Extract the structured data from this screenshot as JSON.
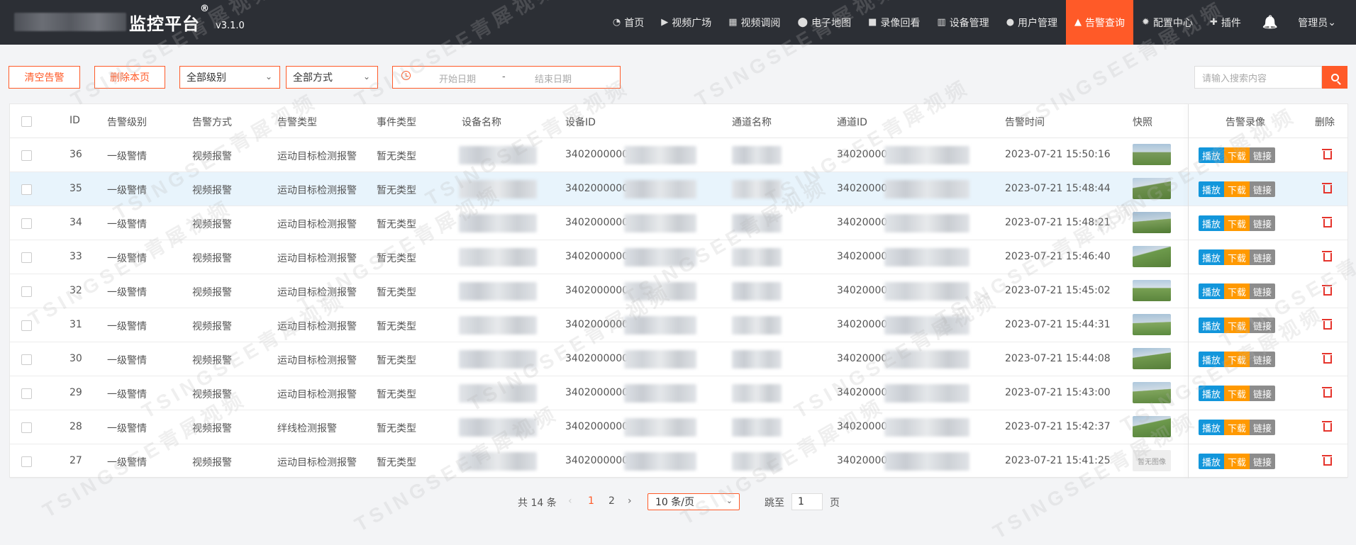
{
  "header": {
    "title": "监控平台",
    "registered": "®",
    "version": "v3.1.0",
    "nav": [
      {
        "label": "首页",
        "icon": "dashboard-icon"
      },
      {
        "label": "视频广场",
        "icon": "play-circle-icon"
      },
      {
        "label": "视频调阅",
        "icon": "grid-icon"
      },
      {
        "label": "电子地图",
        "icon": "map-pin-icon"
      },
      {
        "label": "录像回看",
        "icon": "video-camera-icon"
      },
      {
        "label": "设备管理",
        "icon": "columns-icon"
      },
      {
        "label": "用户管理",
        "icon": "user-icon"
      },
      {
        "label": "告警查询",
        "icon": "alarm-icon",
        "active": true
      },
      {
        "label": "配置中心",
        "icon": "gear-icon"
      },
      {
        "label": "插件",
        "icon": "puzzle-icon"
      }
    ],
    "user": "管理员",
    "accent": "#ff5a28"
  },
  "toolbar": {
    "clear_label": "清空告警",
    "delete_page_label": "删除本页",
    "level_select": "全部级别",
    "method_select": "全部方式",
    "start_date_placeholder": "开始日期",
    "date_sep": "-",
    "end_date_placeholder": "结束日期",
    "search_placeholder": "请输入搜索内容"
  },
  "table": {
    "columns": [
      "ID",
      "告警级别",
      "告警方式",
      "告警类型",
      "事件类型",
      "设备名称",
      "设备ID",
      "通道名称",
      "通道ID",
      "告警时间",
      "快照",
      "告警录像",
      "删除"
    ],
    "rows": [
      {
        "id": "36",
        "level": "一级警情",
        "method": "视频报警",
        "type": "运动目标检测报警",
        "event": "暂无类型",
        "device_id": "3402000000",
        "channel_id": "34020000",
        "time": "2023-07-21 15:50:16"
      },
      {
        "id": "35",
        "level": "一级警情",
        "method": "视频报警",
        "type": "运动目标检测报警",
        "event": "暂无类型",
        "device_id": "3402000000",
        "channel_id": "34020000",
        "time": "2023-07-21 15:48:44"
      },
      {
        "id": "34",
        "level": "一级警情",
        "method": "视频报警",
        "type": "运动目标检测报警",
        "event": "暂无类型",
        "device_id": "3402000000",
        "channel_id": "34020000",
        "time": "2023-07-21 15:48:21"
      },
      {
        "id": "33",
        "level": "一级警情",
        "method": "视频报警",
        "type": "运动目标检测报警",
        "event": "暂无类型",
        "device_id": "3402000000",
        "channel_id": "34020000",
        "time": "2023-07-21 15:46:40"
      },
      {
        "id": "32",
        "level": "一级警情",
        "method": "视频报警",
        "type": "运动目标检测报警",
        "event": "暂无类型",
        "device_id": "3402000000",
        "channel_id": "34020000",
        "time": "2023-07-21 15:45:02"
      },
      {
        "id": "31",
        "level": "一级警情",
        "method": "视频报警",
        "type": "运动目标检测报警",
        "event": "暂无类型",
        "device_id": "3402000000",
        "channel_id": "34020000",
        "time": "2023-07-21 15:44:31"
      },
      {
        "id": "30",
        "level": "一级警情",
        "method": "视频报警",
        "type": "运动目标检测报警",
        "event": "暂无类型",
        "device_id": "3402000000",
        "channel_id": "34020000",
        "time": "2023-07-21 15:44:08"
      },
      {
        "id": "29",
        "level": "一级警情",
        "method": "视频报警",
        "type": "运动目标检测报警",
        "event": "暂无类型",
        "device_id": "3402000000",
        "channel_id": "34020000",
        "time": "2023-07-21 15:43:00"
      },
      {
        "id": "28",
        "level": "一级警情",
        "method": "视频报警",
        "type": "绊线检测报警",
        "event": "暂无类型",
        "device_id": "3402000000",
        "channel_id": "34020000",
        "time": "2023-07-21 15:42:37"
      },
      {
        "id": "27",
        "level": "一级警情",
        "method": "视频报警",
        "type": "运动目标检测报警",
        "event": "暂无类型",
        "device_id": "3402000000",
        "channel_id": "34020000",
        "time": "2023-07-21 15:41:25",
        "no_snapshot": true
      }
    ],
    "actions": {
      "play": "播放",
      "download": "下载",
      "link": "链接"
    },
    "no_image_text": "暂无图像"
  },
  "pagination": {
    "total": "共 14 条",
    "prev": "‹",
    "next": "›",
    "pages": [
      "1",
      "2"
    ],
    "current": "1",
    "page_size": "10 条/页",
    "goto_label": "跳至",
    "goto_value": "1",
    "page_label": "页"
  },
  "watermark": "TSINGSEE青犀视频"
}
